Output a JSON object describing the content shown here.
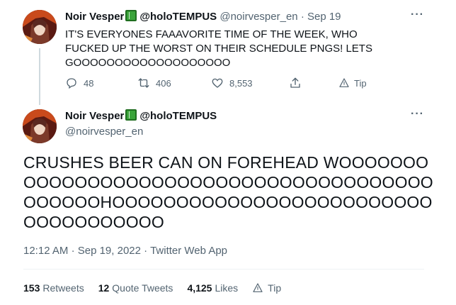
{
  "tweet1": {
    "display_name": "Noir Vesper",
    "name_emoji": "green-book-icon",
    "name_suffix": "@holoTEMPUS",
    "handle": "@noirvesper_en",
    "separator": "·",
    "date": "Sep 19",
    "text": "IT'S EVERYONES FAAAVORITE TIME OF THE WEEK, WHO FUCKED UP THE WORST ON THEIR SCHEDULE PNGS! LETS GOOOOOOOOOOOOOOOOOOO",
    "actions": {
      "reply_count": "48",
      "retweet_count": "406",
      "like_count": "8,553",
      "tip_label": "Tip"
    }
  },
  "tweet2": {
    "display_name": "Noir Vesper",
    "name_emoji": "green-book-icon",
    "name_suffix": "@holoTEMPUS",
    "handle": "@noirvesper_en",
    "text": "CRUSHES BEER CAN ON FOREHEAD WOOOOOOOOOOOOOOOOOOOOOOOOOOOOOOOOOOOOOOOOOOOOOHOOOOOOOOOOOOOOOOOOOOOOOOOOOOOOOOOOOO",
    "time": "12:12 AM",
    "date": "Sep 19, 2022",
    "source": "Twitter Web App",
    "separator": "·",
    "stats": {
      "retweets_count": "153",
      "retweets_label": "Retweets",
      "quotes_count": "12",
      "quotes_label": "Quote Tweets",
      "likes_count": "4,125",
      "likes_label": "Likes",
      "tip_label": "Tip"
    }
  },
  "more_icon": "···",
  "colors": {
    "text_primary": "#0f1419",
    "text_secondary": "#536471",
    "thread_line": "#cfd9de",
    "divider": "#eff3f4"
  }
}
